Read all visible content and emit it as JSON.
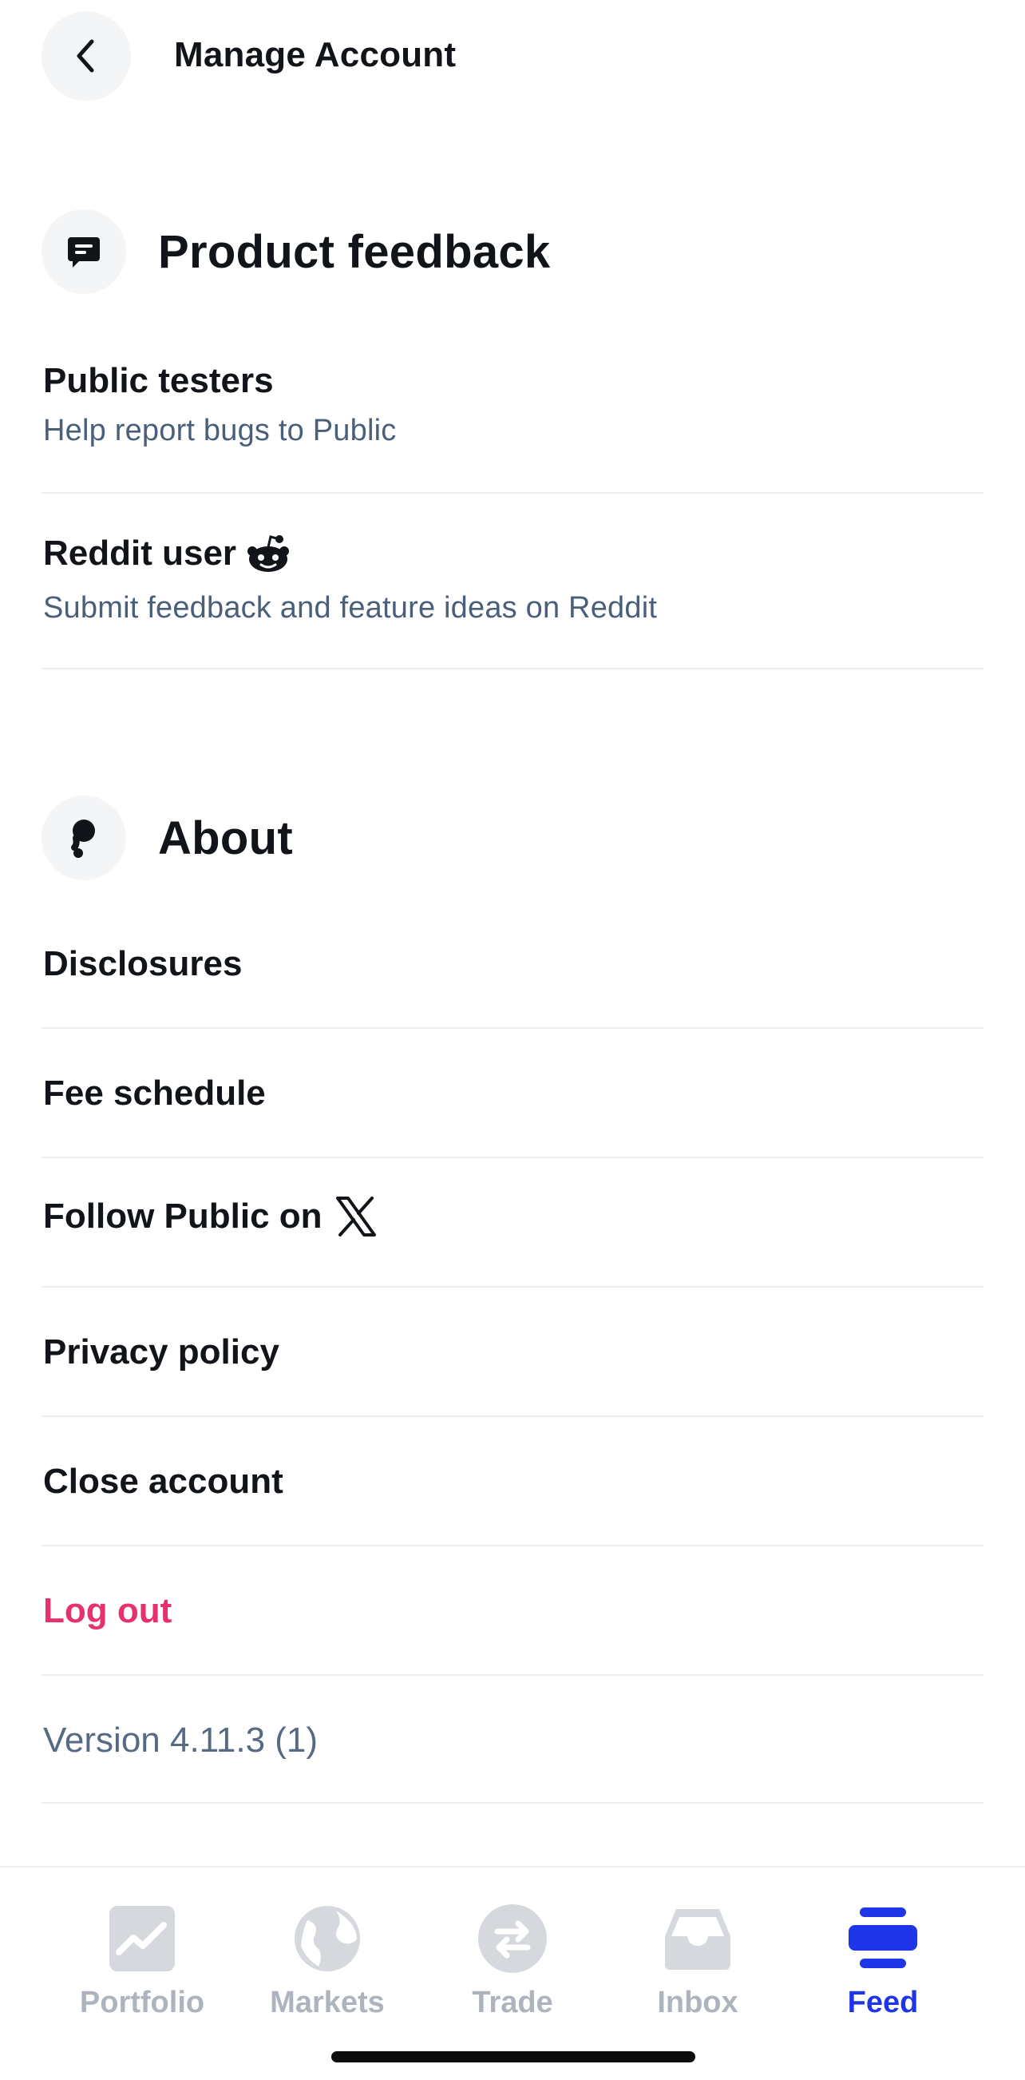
{
  "header": {
    "title": "Manage Account"
  },
  "product_feedback": {
    "title": "Product feedback",
    "items": [
      {
        "title": "Public testers",
        "subtitle": "Help report bugs to Public"
      },
      {
        "title": "Reddit user",
        "subtitle": "Submit feedback and feature ideas on Reddit"
      }
    ]
  },
  "about": {
    "title": "About",
    "items": [
      {
        "title": "Disclosures"
      },
      {
        "title": "Fee schedule"
      },
      {
        "title": "Follow Public on"
      },
      {
        "title": "Privacy policy"
      },
      {
        "title": "Close account"
      },
      {
        "title": "Log out"
      },
      {
        "title": "Version 4.11.3 (1)"
      }
    ]
  },
  "tabs": [
    {
      "label": "Portfolio",
      "icon": "portfolio-icon",
      "active": false
    },
    {
      "label": "Markets",
      "icon": "globe-icon",
      "active": false
    },
    {
      "label": "Trade",
      "icon": "swap-icon",
      "active": false
    },
    {
      "label": "Inbox",
      "icon": "inbox-icon",
      "active": false
    },
    {
      "label": "Feed",
      "icon": "feed-icon",
      "active": true
    }
  ],
  "colors": {
    "accent": "#1e35e8",
    "danger": "#e6316e",
    "subtitle": "#4a5f7a",
    "tab_inactive": "#aeb4bd"
  }
}
